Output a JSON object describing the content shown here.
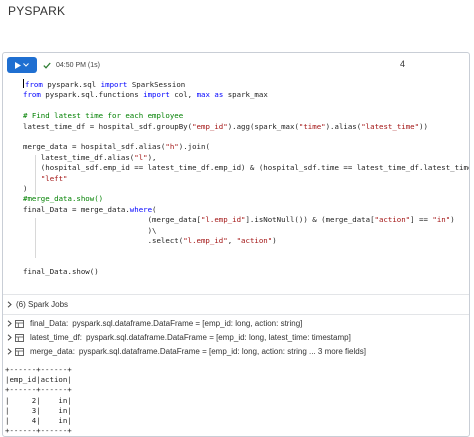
{
  "page": {
    "title": "PYSPARK"
  },
  "cell": {
    "exec_time": "04:50 PM (1s)",
    "cell_number": "4",
    "code_lines": [
      [
        {
          "t": "from",
          "c": "kw"
        },
        {
          "t": " pyspark.sql "
        },
        {
          "t": "import",
          "c": "kw"
        },
        {
          "t": " SparkSession"
        }
      ],
      [
        {
          "t": "from",
          "c": "kw"
        },
        {
          "t": " pyspark.sql.functions "
        },
        {
          "t": "import",
          "c": "kw"
        },
        {
          "t": " col, "
        },
        {
          "t": "max",
          "c": "kw"
        },
        {
          "t": " "
        },
        {
          "t": "as",
          "c": "kw"
        },
        {
          "t": " spark_max"
        }
      ],
      [],
      [
        {
          "t": "# Find latest time for each employee",
          "c": "cm"
        }
      ],
      [
        {
          "t": "latest_time_df = hospital_sdf.groupBy("
        },
        {
          "t": "\"emp_id\"",
          "c": "str"
        },
        {
          "t": ").agg(spark_max("
        },
        {
          "t": "\"time\"",
          "c": "str"
        },
        {
          "t": ").alias("
        },
        {
          "t": "\"latest_time\"",
          "c": "str"
        },
        {
          "t": "))"
        }
      ],
      [],
      [
        {
          "t": "merge_data = hospital_sdf.alias("
        },
        {
          "t": "\"h\"",
          "c": "str"
        },
        {
          "t": ").join("
        }
      ],
      [
        {
          "t": "    latest_time_df.alias("
        },
        {
          "t": "\"l\"",
          "c": "str"
        },
        {
          "t": "),"
        }
      ],
      [
        {
          "t": "    (hospital_sdf.emp_id == latest_time_df.emp_id) & (hospital_sdf.time == latest_time_df.latest_time),"
        }
      ],
      [
        {
          "t": "    "
        },
        {
          "t": "\"left\"",
          "c": "str"
        }
      ],
      [
        {
          "t": ")"
        }
      ],
      [
        {
          "t": "#merge_data.show()",
          "c": "cm"
        }
      ],
      [
        {
          "t": "final_Data = merge_data."
        },
        {
          "t": "where",
          "c": "kw"
        },
        {
          "t": "("
        }
      ],
      [
        {
          "t": "                            (merge_data["
        },
        {
          "t": "\"l.emp_id\"",
          "c": "str"
        },
        {
          "t": "].isNotNull()) & (merge_data["
        },
        {
          "t": "\"action\"",
          "c": "str"
        },
        {
          "t": "] == "
        },
        {
          "t": "\"in\"",
          "c": "str"
        },
        {
          "t": ")"
        }
      ],
      [
        {
          "t": "                            )\\"
        }
      ],
      [
        {
          "t": "                            .select("
        },
        {
          "t": "\"l.emp_id\"",
          "c": "str"
        },
        {
          "t": ", "
        },
        {
          "t": "\"action\"",
          "c": "str"
        },
        {
          "t": ")"
        }
      ],
      [],
      [],
      [
        {
          "t": "final_Data.show()"
        }
      ]
    ]
  },
  "spark_jobs": {
    "label": "(6) Spark Jobs"
  },
  "dataframes": [
    {
      "name": "final_Data:",
      "type": "pyspark.sql.dataframe.DataFrame = [emp_id: long, action: string]"
    },
    {
      "name": "latest_time_df:",
      "type": "pyspark.sql.dataframe.DataFrame = [emp_id: long, latest_time: timestamp]"
    },
    {
      "name": "merge_data:",
      "type": "pyspark.sql.dataframe.DataFrame = [emp_id: long, action: string ... 3 more fields]"
    }
  ],
  "output_lines": [
    "+------+------+",
    "|emp_id|action|",
    "+------+------+",
    "|     2|    in|",
    "|     3|    in|",
    "|     4|    in|",
    "+------+------+"
  ],
  "colors": {
    "run_button": "#1f6fd1",
    "keyword": "#0000ff",
    "string": "#a31515",
    "comment": "#008000"
  },
  "icons": [
    "play-icon",
    "chevron-down-icon",
    "check-icon",
    "chevron-right-icon",
    "table-icon"
  ]
}
